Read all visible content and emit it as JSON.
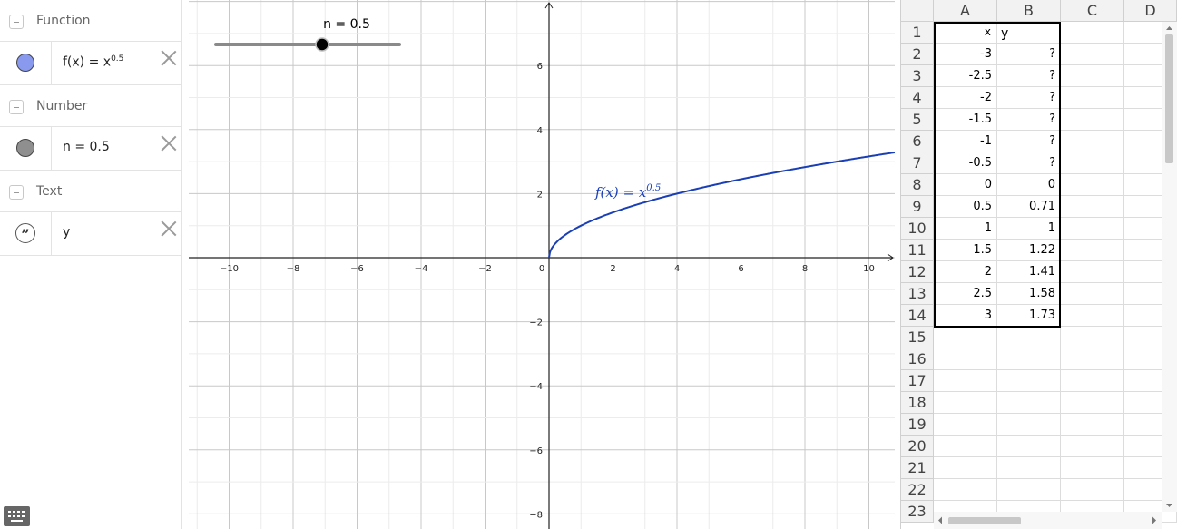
{
  "algebra": {
    "categories": {
      "function": "Function",
      "number": "Number",
      "text": "Text"
    },
    "function_item": {
      "lhs": "f(x) = x",
      "exponent": "0.5",
      "color": "#8899ee"
    },
    "number_item": {
      "text": "n = 0.5",
      "color": "#8f8f8f"
    },
    "text_item": {
      "text": "y"
    }
  },
  "graphics": {
    "slider_label": "n = 0.5",
    "slider_value": 0.5,
    "slider_min": -5,
    "slider_max": 5,
    "curve_label_main": "f(x) = x",
    "curve_label_exp": "0.5",
    "curve_color": "#1a3fb5",
    "x_ticks": [
      "−10",
      "−8",
      "−6",
      "−4",
      "−2",
      "0",
      "2",
      "4",
      "6",
      "8",
      "10"
    ],
    "y_ticks": [
      "6",
      "4",
      "2",
      "−2",
      "−4",
      "−6",
      "−8"
    ]
  },
  "chart_data": {
    "type": "line",
    "title": "",
    "series": [
      {
        "name": "f(x) = x^0.5",
        "x": [
          0,
          0.5,
          1,
          1.5,
          2,
          2.5,
          3,
          4,
          6,
          8,
          10,
          11
        ],
        "y": [
          0,
          0.71,
          1,
          1.22,
          1.41,
          1.58,
          1.73,
          2,
          2.45,
          2.83,
          3.16,
          3.32
        ]
      }
    ],
    "xlim": [
      -11,
      11
    ],
    "ylim": [
      -8,
      8
    ],
    "grid": true
  },
  "spreadsheet": {
    "columns": [
      "A",
      "B",
      "C",
      "D"
    ],
    "header_row": {
      "A": "x",
      "B": "y"
    },
    "rows": [
      {
        "row": "1",
        "A": "x",
        "B": "y"
      },
      {
        "row": "2",
        "A": "-3",
        "B": "?"
      },
      {
        "row": "3",
        "A": "-2.5",
        "B": "?"
      },
      {
        "row": "4",
        "A": "-2",
        "B": "?"
      },
      {
        "row": "5",
        "A": "-1.5",
        "B": "?"
      },
      {
        "row": "6",
        "A": "-1",
        "B": "?"
      },
      {
        "row": "7",
        "A": "-0.5",
        "B": "?"
      },
      {
        "row": "8",
        "A": "0",
        "B": "0"
      },
      {
        "row": "9",
        "A": "0.5",
        "B": "0.71"
      },
      {
        "row": "10",
        "A": "1",
        "B": "1"
      },
      {
        "row": "11",
        "A": "1.5",
        "B": "1.22"
      },
      {
        "row": "12",
        "A": "2",
        "B": "1.41"
      },
      {
        "row": "13",
        "A": "2.5",
        "B": "1.58"
      },
      {
        "row": "14",
        "A": "3",
        "B": "1.73"
      }
    ],
    "empty_row_numbers": [
      "15",
      "16",
      "17",
      "18",
      "19",
      "20",
      "21",
      "22",
      "23"
    ]
  }
}
